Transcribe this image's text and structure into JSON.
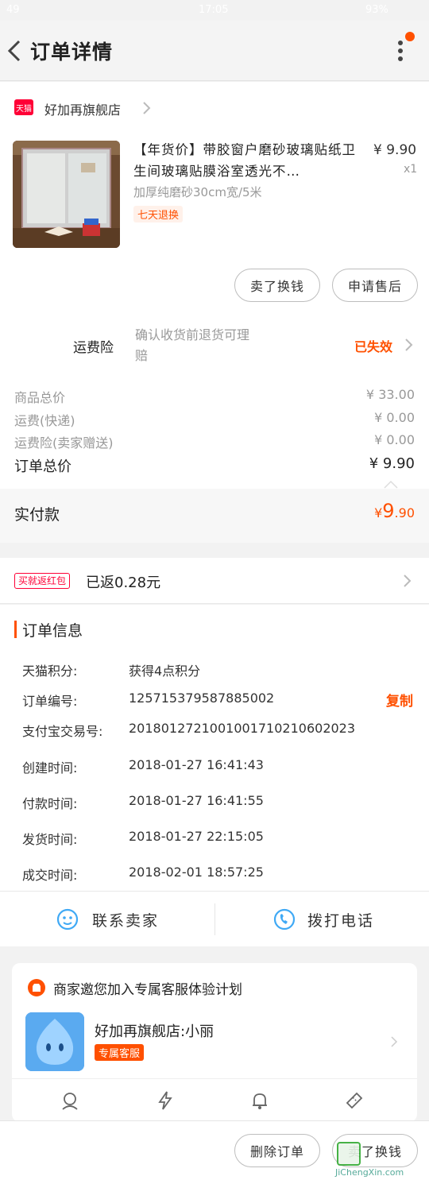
{
  "status_bar": {
    "carrier": "49",
    "time": "17:05",
    "battery": "93%"
  },
  "nav": {
    "title": "订单详情"
  },
  "shop": {
    "badge": "天猫",
    "name": "好加再旗舰店"
  },
  "product": {
    "title": "【年货价】带胶窗户磨砂玻璃贴纸卫生间玻璃贴膜浴室透光不…",
    "sku": "加厚纯磨砂30cm宽/5米",
    "tag": "七天退换",
    "price": "¥ 9.90",
    "qty": "x1"
  },
  "item_actions": {
    "sell_label": "卖了换钱",
    "aftersale_label": "申请售后"
  },
  "insurance": {
    "label": "运费险",
    "desc_line1": "确认收货前退货可理",
    "desc_line2": "赔",
    "status": "已失效"
  },
  "price_rows": [
    {
      "label": "商品总价",
      "value": "¥ 33.00"
    },
    {
      "label": "运费(快递)",
      "value": "¥ 0.00"
    },
    {
      "label": "运费险(卖家赠送)",
      "value": "¥ 0.00"
    }
  ],
  "order_total": {
    "label": "订单总价",
    "value": "¥ 9.90"
  },
  "paid": {
    "label": "实付款",
    "currency": "¥",
    "int": "9",
    "dec": ".90"
  },
  "rebate": {
    "badge": "买就返红包",
    "text": "已返0.28元"
  },
  "order_info": {
    "title": "订单信息",
    "copy_label": "复制",
    "rows": [
      {
        "label": "天猫积分:",
        "value": "获得4点积分"
      },
      {
        "label": "订单编号:",
        "value": "125715379587885002"
      },
      {
        "label": "支付宝交易号:",
        "value": "2018012721001001710210602023"
      },
      {
        "label": "创建时间:",
        "value": "2018-01-27 16:41:43"
      },
      {
        "label": "付款时间:",
        "value": "2018-01-27 16:41:55"
      },
      {
        "label": "发货时间:",
        "value": "2018-01-27 22:15:05"
      },
      {
        "label": "成交时间:",
        "value": "2018-02-01 18:57:25"
      }
    ]
  },
  "contact": {
    "seller_label": "联系卖家",
    "call_label": "拨打电话"
  },
  "service": {
    "invite_text": "商家邀您加入专属客服体验计划",
    "agent_name": "好加再旗舰店:小丽",
    "agent_tag": "专属客服"
  },
  "bottom": {
    "delete_label": "删除订单",
    "sell_label": "卖了换钱"
  },
  "watermark": {
    "text": "JiChengXin.com"
  },
  "colors": {
    "accent": "#ff5000",
    "tmall_red": "#ff0036",
    "link_blue": "#3fa9f5"
  }
}
